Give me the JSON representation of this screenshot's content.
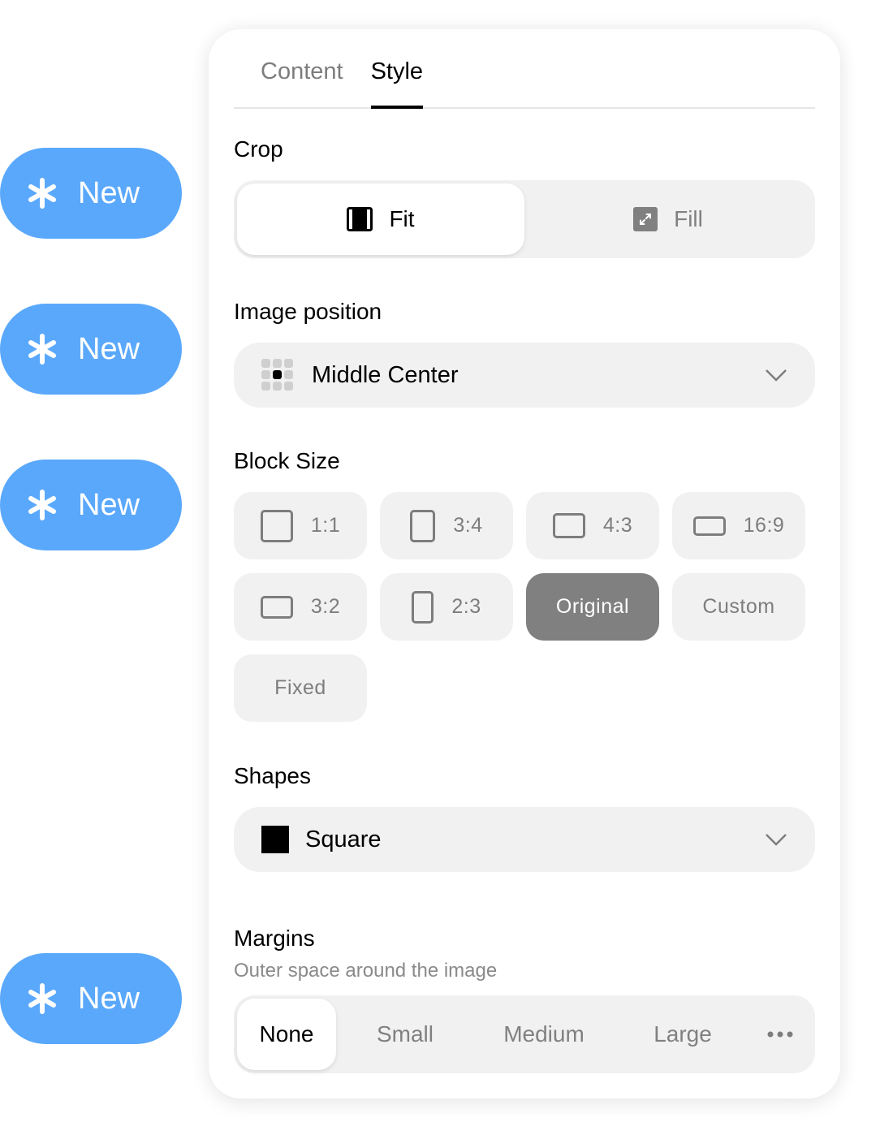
{
  "side_buttons": [
    {
      "label": "New",
      "icon": "asterisk-icon"
    },
    {
      "label": "New",
      "icon": "asterisk-icon"
    },
    {
      "label": "New",
      "icon": "asterisk-icon"
    },
    {
      "label": "New",
      "icon": "asterisk-icon"
    }
  ],
  "colors": {
    "accent_blue": "#5aa8fb",
    "selected_gray": "#808080",
    "control_bg": "#f1f1f1"
  },
  "tabs": [
    {
      "label": "Content",
      "active": false
    },
    {
      "label": "Style",
      "active": true
    }
  ],
  "crop": {
    "label": "Crop",
    "options": [
      {
        "label": "Fit",
        "icon": "fit-icon",
        "selected": true
      },
      {
        "label": "Fill",
        "icon": "fill-expand-icon",
        "selected": false
      }
    ]
  },
  "image_position": {
    "label": "Image position",
    "value": "Middle Center",
    "icon": "position-grid-icon"
  },
  "block_size": {
    "label": "Block Size",
    "options": [
      {
        "label": "1:1",
        "icon": "ratio-1-1-icon",
        "selected": false
      },
      {
        "label": "3:4",
        "icon": "ratio-3-4-icon",
        "selected": false
      },
      {
        "label": "4:3",
        "icon": "ratio-4-3-icon",
        "selected": false
      },
      {
        "label": "16:9",
        "icon": "ratio-16-9-icon",
        "selected": false
      },
      {
        "label": "3:2",
        "icon": "ratio-3-2-icon",
        "selected": false
      },
      {
        "label": "2:3",
        "icon": "ratio-2-3-icon",
        "selected": false
      },
      {
        "label": "Original",
        "selected": true
      },
      {
        "label": "Custom",
        "selected": false
      },
      {
        "label": "Fixed",
        "selected": false
      }
    ]
  },
  "shapes": {
    "label": "Shapes",
    "value": "Square",
    "icon": "square-shape-icon"
  },
  "margins": {
    "label": "Margins",
    "description": "Outer space around the image",
    "options": [
      {
        "label": "None",
        "selected": true
      },
      {
        "label": "Small",
        "selected": false
      },
      {
        "label": "Medium",
        "selected": false
      },
      {
        "label": "Large",
        "selected": false
      }
    ],
    "more_icon": "more-horizontal-icon"
  }
}
